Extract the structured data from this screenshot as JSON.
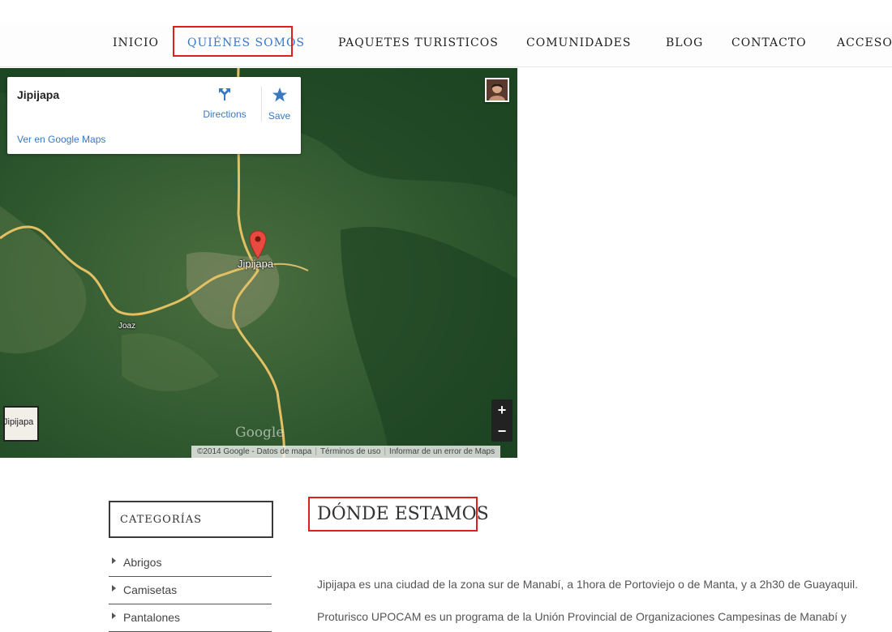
{
  "nav": {
    "items": [
      "INICIO",
      "QUIÉNES SOMOS",
      "PAQUETES TURISTICOS",
      "COMUNIDADES",
      "BLOG",
      "CONTACTO",
      "ACCESO"
    ],
    "active": "QUIÉNES SOMOS"
  },
  "map": {
    "place_name": "Jipijapa",
    "view_link": "Ver en Google Maps",
    "directions_label": "Directions",
    "save_label": "Save",
    "city_label": "Jipijapa",
    "town_label": "Joaz",
    "minimap_label": "Jipijapa",
    "zoom_in": "+",
    "zoom_out": "−",
    "logo": "Google",
    "attribution": "©2014 Google - Datos de mapa",
    "terms": "Términos de uso",
    "report": "Informar de un error de Maps"
  },
  "sidebar": {
    "heading": "CATEGORÍAS",
    "items": [
      "Abrigos",
      "Camisetas",
      "Pantalones"
    ]
  },
  "content": {
    "title": "DÓNDE ESTAMOS",
    "paragraph1": "Jipijapa es una ciudad de la zona sur de Manabí, a 1hora de Portoviejo o de Manta, y a 2h30 de Guayaquil.",
    "paragraph2": "Proturisco UPOCAM es un programa de la Unión Provincial de Organizaciones Campesinas de Manabí y"
  },
  "colors": {
    "accent": "#3a78c2",
    "highlight_border": "#e11d1d",
    "map_green": "#2d5a2f",
    "road": "#e2c063"
  },
  "icons": [
    "directions-icon",
    "star-icon",
    "map-pin-icon",
    "avatar"
  ]
}
